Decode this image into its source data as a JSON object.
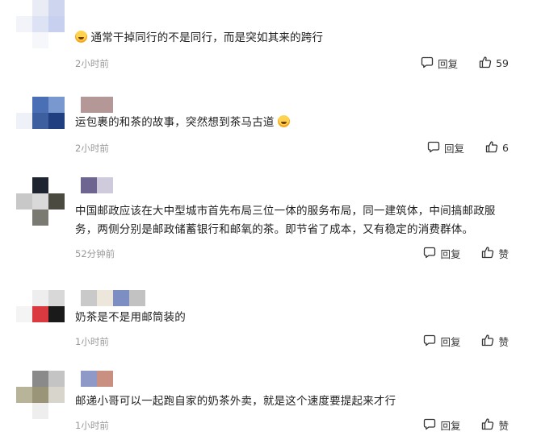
{
  "comments": [
    {
      "text": "通常干掉同行的不是同行，而是突如其来的跨行",
      "emoji_position": "start",
      "time": "2小时前",
      "reply_label": "回复",
      "like_label": "59"
    },
    {
      "text": "运包裹的和茶的故事，突然想到茶马古道",
      "emoji_position": "end",
      "time": "2小时前",
      "reply_label": "回复",
      "like_label": "6"
    },
    {
      "text": "中国邮政应该在大中型城市首先布局三位一体的服务布局，同一建筑体，中间搞邮政服务，两侧分别是邮政储蓄银行和邮氧的茶。即节省了成本，又有稳定的消费群体。",
      "emoji_position": "none",
      "time": "52分钟前",
      "reply_label": "回复",
      "like_label": "赞"
    },
    {
      "text": "奶茶是不是用邮筒装的",
      "emoji_position": "none",
      "time": "1小时前",
      "reply_label": "回复",
      "like_label": "赞"
    },
    {
      "text": "邮递小哥可以一起跑自家的奶茶外卖，就是这个速度要提起来才行",
      "emoji_position": "none",
      "time": "1小时前",
      "reply_label": "回复",
      "like_label": "赞"
    }
  ],
  "icons": {
    "reply": "comment-bubble-icon",
    "like": "thumbs-up-icon",
    "emoji": "laughing-face-emoji"
  },
  "colors": {
    "text": "#222222",
    "meta": "#999999"
  }
}
